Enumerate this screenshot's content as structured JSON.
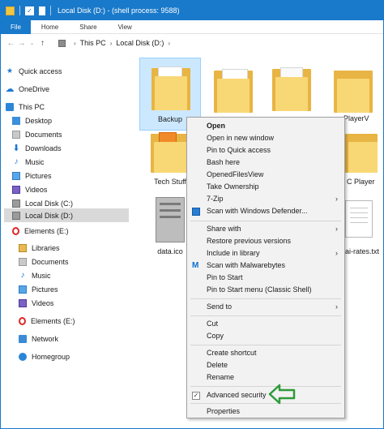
{
  "window": {
    "title": "Local Disk (D:) - (shell process: 9588)"
  },
  "ribbon": {
    "tabs": [
      "File",
      "Home",
      "Share",
      "View"
    ]
  },
  "address": {
    "crumbs": [
      "This PC",
      "Local Disk (D:)"
    ]
  },
  "nav_pane": {
    "items": [
      {
        "label": "Quick access",
        "icon": "star-icon"
      },
      {
        "label": "OneDrive",
        "icon": "cloud-icon"
      },
      {
        "label": "This PC",
        "icon": "computer-icon"
      },
      {
        "label": "Desktop",
        "icon": "desktop-icon"
      },
      {
        "label": "Documents",
        "icon": "documents-icon"
      },
      {
        "label": "Downloads",
        "icon": "download-icon"
      },
      {
        "label": "Music",
        "icon": "music-icon"
      },
      {
        "label": "Pictures",
        "icon": "pictures-icon"
      },
      {
        "label": "Videos",
        "icon": "videos-icon"
      },
      {
        "label": "Local Disk (C:)",
        "icon": "drive-icon"
      },
      {
        "label": "Local Disk (D:)",
        "icon": "drive-icon"
      },
      {
        "label": "Elements (E:)",
        "icon": "opera-icon"
      },
      {
        "label": "Libraries",
        "icon": "libraries-icon"
      },
      {
        "label": "Documents",
        "icon": "documents-icon"
      },
      {
        "label": "Music",
        "icon": "music-icon"
      },
      {
        "label": "Pictures",
        "icon": "pictures-icon"
      },
      {
        "label": "Videos",
        "icon": "videos-icon"
      },
      {
        "label": "Elements (E:)",
        "icon": "opera-icon"
      },
      {
        "label": "Network",
        "icon": "network-icon"
      },
      {
        "label": "Homegroup",
        "icon": "homegroup-icon"
      }
    ]
  },
  "content": {
    "items": [
      {
        "label": "Backup",
        "icon": "folder-icon"
      },
      {
        "label": "",
        "icon": "folder-icon"
      },
      {
        "label": "",
        "icon": "folder-icon"
      },
      {
        "label": "PlayerV",
        "icon": "folder-icon"
      },
      {
        "label": "Tech Stuff",
        "icon": "folder-icon"
      },
      {
        "label": "C Player",
        "icon": "folder-icon"
      },
      {
        "label": "data.ico",
        "icon": "server-icon"
      },
      {
        "label": "ai-rates.txt",
        "icon": "text-file-icon"
      }
    ]
  },
  "context_menu": {
    "items": [
      {
        "label": "Open"
      },
      {
        "label": "Open in new window"
      },
      {
        "label": "Pin to Quick access"
      },
      {
        "label": "Bash here"
      },
      {
        "label": "OpenedFilesView"
      },
      {
        "label": "Take Ownership"
      },
      {
        "label": "7-Zip"
      },
      {
        "label": "Scan with Windows Defender..."
      },
      {
        "label": "Share with"
      },
      {
        "label": "Restore previous versions"
      },
      {
        "label": "Include in library"
      },
      {
        "label": "Scan with Malwarebytes"
      },
      {
        "label": "Pin to Start"
      },
      {
        "label": "Pin to Start menu (Classic Shell)"
      },
      {
        "label": "Send to"
      },
      {
        "label": "Cut"
      },
      {
        "label": "Copy"
      },
      {
        "label": "Create shortcut"
      },
      {
        "label": "Delete"
      },
      {
        "label": "Rename"
      },
      {
        "label": "Advanced security"
      },
      {
        "label": "Properties"
      }
    ]
  },
  "colors": {
    "titlebar": "#1979ca",
    "selection": "#cce8ff",
    "annotation_arrow": "#2e9b3a"
  }
}
